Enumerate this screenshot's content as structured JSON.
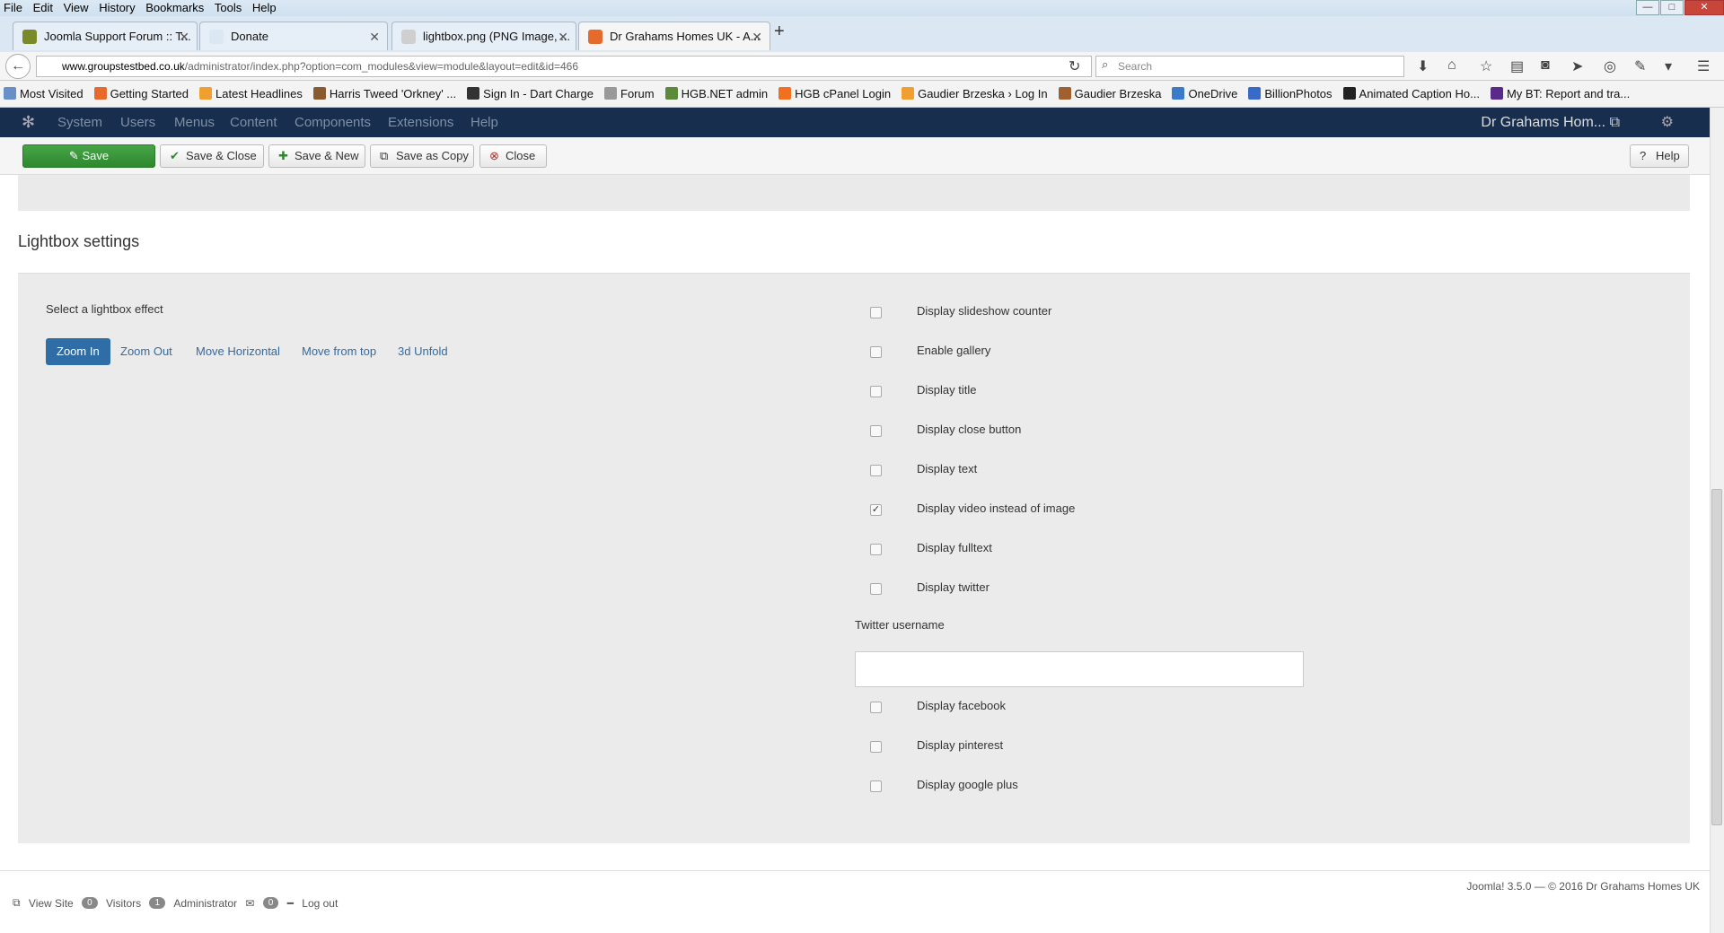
{
  "menubar": {
    "items": [
      "File",
      "Edit",
      "View",
      "History",
      "Bookmarks",
      "Tools",
      "Help"
    ]
  },
  "window_controls": {
    "min": "—",
    "max": "□",
    "close": "✕"
  },
  "tabs": [
    {
      "label": "Joomla Support Forum :: T...",
      "fav_color": "#7a8a2a"
    },
    {
      "label": "Donate",
      "fav_color": "#dbe7f3"
    },
    {
      "label": "lightbox.png (PNG Image, ...",
      "fav_color": "#cfcfcf"
    },
    {
      "label": "Dr Grahams Homes UK - A...",
      "fav_color": "#e66a2c"
    }
  ],
  "browser": {
    "url_host": "www.groupstestbed.co.uk",
    "url_path": "/administrator/index.php?option=com_modules&view=module&layout=edit&id=466",
    "search_placeholder": "Search"
  },
  "bookmarks": [
    {
      "label": "Most Visited",
      "color": "#6a8fc8"
    },
    {
      "label": "Getting Started",
      "color": "#e66a2c"
    },
    {
      "label": "Latest Headlines",
      "color": "#f0a030"
    },
    {
      "label": "Harris Tweed 'Orkney' ...",
      "color": "#8a5a30"
    },
    {
      "label": "Sign In - Dart Charge",
      "color": "#333333"
    },
    {
      "label": "Forum",
      "color": "#999999"
    },
    {
      "label": "HGB.NET admin",
      "color": "#5a8a3a"
    },
    {
      "label": "HGB cPanel Login",
      "color": "#f07020"
    },
    {
      "label": "Gaudier Brzeska › Log In",
      "color": "#f0a030"
    },
    {
      "label": "Gaudier Brzeska",
      "color": "#a06030"
    },
    {
      "label": "OneDrive",
      "color": "#3a7ac8"
    },
    {
      "label": "BillionPhotos",
      "color": "#3a6ac8"
    },
    {
      "label": "Animated Caption Ho...",
      "color": "#222222"
    },
    {
      "label": "My BT: Report and tra...",
      "color": "#5a2a8a"
    }
  ],
  "joomla": {
    "nav": [
      "System",
      "Users",
      "Menus",
      "Content",
      "Components",
      "Extensions",
      "Help"
    ],
    "site_name": "Dr Grahams Hom..."
  },
  "toolbar": {
    "save": "Save",
    "save_close": "Save & Close",
    "save_new": "Save & New",
    "save_copy": "Save as Copy",
    "close": "Close",
    "help": "Help"
  },
  "lightbox": {
    "title": "Lightbox settings",
    "effect_label": "Select a lightbox effect",
    "effects": [
      "Zoom In",
      "Zoom Out",
      "Move Horizontal",
      "Move from top",
      "3d Unfold"
    ],
    "selected_effect": "Zoom In",
    "options_top": [
      {
        "label": "Display slideshow counter",
        "checked": false
      },
      {
        "label": "Enable gallery",
        "checked": false
      },
      {
        "label": "Display title",
        "checked": false
      },
      {
        "label": "Display close button",
        "checked": false
      },
      {
        "label": "Display text",
        "checked": false
      },
      {
        "label": "Display video instead of image",
        "checked": true
      },
      {
        "label": "Display fulltext",
        "checked": false
      },
      {
        "label": "Display twitter",
        "checked": false
      }
    ],
    "twitter_label": "Twitter username",
    "twitter_value": "",
    "options_bottom": [
      {
        "label": "Display facebook",
        "checked": false
      },
      {
        "label": "Display pinterest",
        "checked": false
      },
      {
        "label": "Display google plus",
        "checked": false
      }
    ]
  },
  "footer": {
    "version": "Joomla! 3.5.0 — © 2016 Dr Grahams Homes UK",
    "view_site": "View Site",
    "visitors_count": "0",
    "visitors_label": "Visitors",
    "admin_count": "1",
    "admin_label": "Administrator",
    "messages_count": "0",
    "logout": "Log out"
  }
}
